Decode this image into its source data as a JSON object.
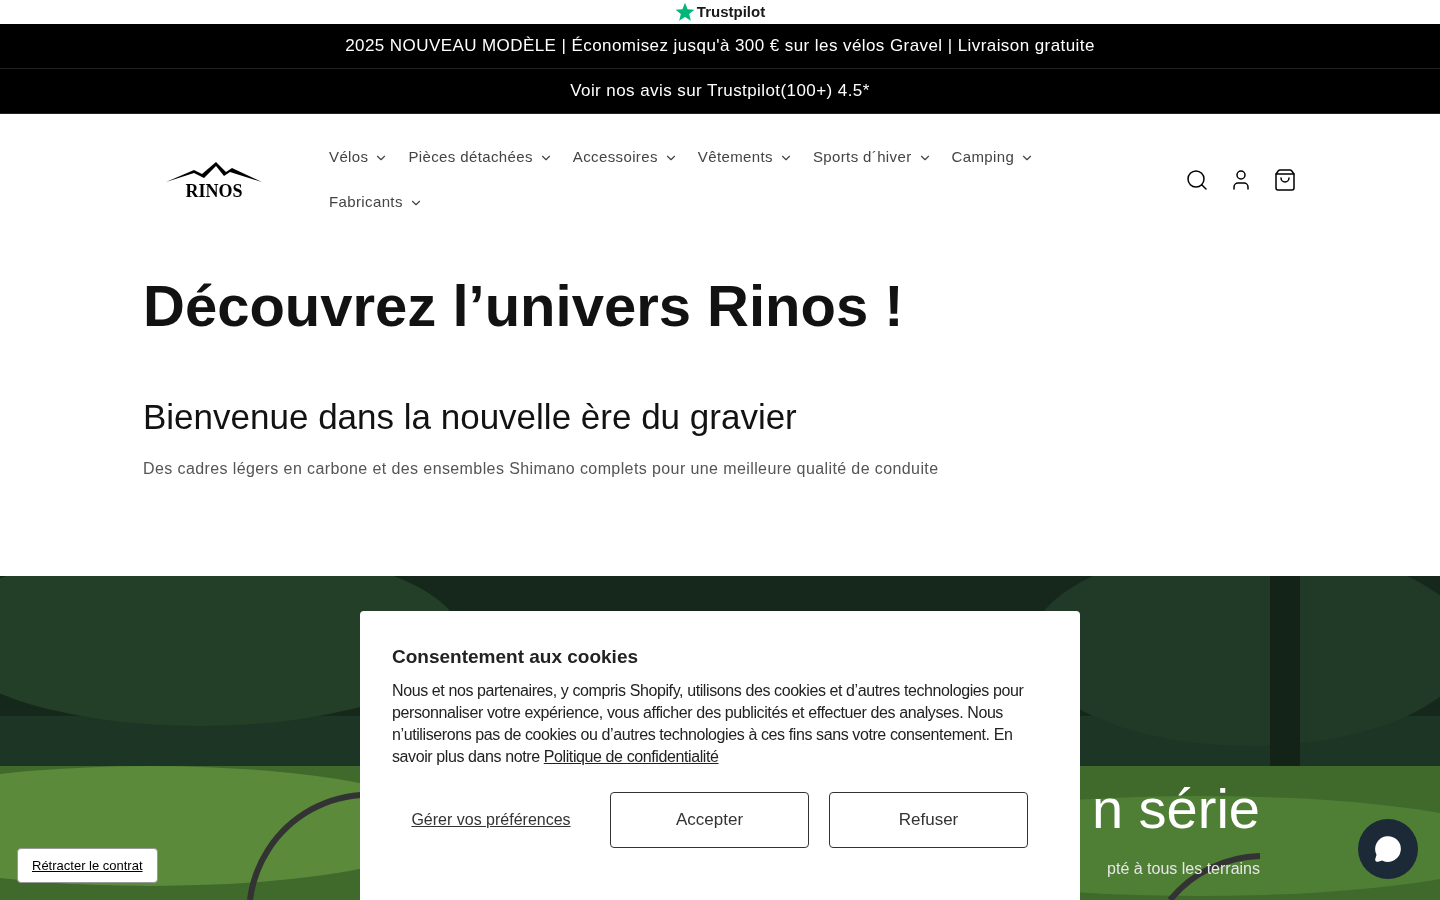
{
  "trustpilot_logo": {
    "text": "Trustpilot"
  },
  "announcements": [
    "2025 NOUVEAU MODÈLE | Économisez jusqu'à 300 € sur les vélos Gravel | Livraison gratuite",
    "Voir nos avis sur Trustpilot(100+) 4.5*"
  ],
  "header": {
    "logo": "RINOS",
    "nav": [
      "Vélos",
      "Pièces détachées",
      "Accessoires",
      "Vêtements",
      "Sports d´hiver",
      "Camping",
      "Fabricants"
    ]
  },
  "intro": {
    "title": "Découvrez l’univers Rinos !",
    "subtitle": "Bienvenue dans la nouvelle ère du gravier",
    "text": "Des cadres légers en carbone et des ensembles Shimano complets pour une meilleure qualité de conduite"
  },
  "hero": {
    "kind": "picture",
    "title": "n série",
    "text": "pté à tous les terrains"
  },
  "cookie_banner": {
    "title": "Consentement aux cookies",
    "text": "Nous et nos partenaires, y compris Shopify, utilisons des cookies et d’autres technologies pour personnaliser votre expérience, vous afficher des publicités et effectuer des analyses. Nous n’utiliserons pas de cookies ou d’autres technologies à ces fins sans votre consentement. En savoir plus dans notre",
    "link": "Politique de confidentialité",
    "manage": "Gérer vos préférences",
    "accept": "Accepter",
    "refuse": "Refuser"
  },
  "retract_button": "Rétracter le contrat"
}
